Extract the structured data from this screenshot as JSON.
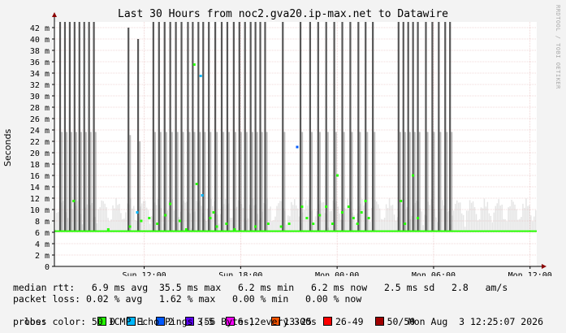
{
  "chart_data": {
    "type": "bar",
    "title": "Last 30 Hours from noc2.gva20.ip-max.net to Datawire",
    "ylabel": "Seconds",
    "ylim": [
      0,
      0.043
    ],
    "yticks": [
      0,
      0.002,
      0.004,
      0.006,
      0.008,
      0.01,
      0.012,
      0.014,
      0.016,
      0.018,
      0.02,
      0.022,
      0.024,
      0.026,
      0.028,
      0.03,
      0.032,
      0.034,
      0.036,
      0.038,
      0.04,
      0.042
    ],
    "ytick_labels": [
      "0",
      "2 m",
      "4 m",
      "6 m",
      "8 m",
      "10 m",
      "12 m",
      "14 m",
      "16 m",
      "18 m",
      "20 m",
      "22 m",
      "24 m",
      "26 m",
      "28 m",
      "30 m",
      "32 m",
      "34 m",
      "36 m",
      "38 m",
      "40 m",
      "42 m"
    ],
    "xlim": [
      0,
      30
    ],
    "xticks": [
      5.583,
      11.583,
      17.583,
      23.583,
      29.583
    ],
    "xtick_labels": [
      "Sun 12:00",
      "Sun 18:00",
      "Mon 00:00",
      "Mon 06:00",
      "Mon 12:00"
    ],
    "grid": true,
    "median_rtt_s": 0.0062,
    "spikes": [
      {
        "x": 0.35,
        "top": 0.043
      },
      {
        "x": 0.65,
        "top": 0.043
      },
      {
        "x": 0.95,
        "top": 0.043
      },
      {
        "x": 1.25,
        "top": 0.043
      },
      {
        "x": 1.55,
        "top": 0.043
      },
      {
        "x": 1.85,
        "top": 0.043
      },
      {
        "x": 2.15,
        "top": 0.043
      },
      {
        "x": 2.45,
        "top": 0.043
      },
      {
        "x": 4.6,
        "top": 0.042
      },
      {
        "x": 5.2,
        "top": 0.04
      },
      {
        "x": 6.15,
        "top": 0.043
      },
      {
        "x": 6.5,
        "top": 0.043
      },
      {
        "x": 6.85,
        "top": 0.043
      },
      {
        "x": 7.2,
        "top": 0.043
      },
      {
        "x": 7.55,
        "top": 0.043
      },
      {
        "x": 7.9,
        "top": 0.043
      },
      {
        "x": 8.3,
        "top": 0.043
      },
      {
        "x": 8.6,
        "top": 0.043
      },
      {
        "x": 8.95,
        "top": 0.043
      },
      {
        "x": 9.25,
        "top": 0.043
      },
      {
        "x": 9.6,
        "top": 0.043
      },
      {
        "x": 10.0,
        "top": 0.043
      },
      {
        "x": 10.4,
        "top": 0.043
      },
      {
        "x": 10.75,
        "top": 0.043
      },
      {
        "x": 11.15,
        "top": 0.043
      },
      {
        "x": 11.5,
        "top": 0.043
      },
      {
        "x": 11.85,
        "top": 0.043
      },
      {
        "x": 12.2,
        "top": 0.043
      },
      {
        "x": 12.5,
        "top": 0.043
      },
      {
        "x": 12.8,
        "top": 0.043
      },
      {
        "x": 13.1,
        "top": 0.043
      },
      {
        "x": 14.2,
        "top": 0.043
      },
      {
        "x": 15.3,
        "top": 0.043
      },
      {
        "x": 15.9,
        "top": 0.043
      },
      {
        "x": 16.4,
        "top": 0.043
      },
      {
        "x": 16.9,
        "top": 0.043
      },
      {
        "x": 17.4,
        "top": 0.043
      },
      {
        "x": 17.9,
        "top": 0.043
      },
      {
        "x": 18.4,
        "top": 0.043
      },
      {
        "x": 18.9,
        "top": 0.043
      },
      {
        "x": 19.35,
        "top": 0.043
      },
      {
        "x": 19.8,
        "top": 0.043
      },
      {
        "x": 21.4,
        "top": 0.043
      },
      {
        "x": 21.7,
        "top": 0.043
      },
      {
        "x": 22.0,
        "top": 0.043
      },
      {
        "x": 22.3,
        "top": 0.043
      },
      {
        "x": 22.6,
        "top": 0.043
      },
      {
        "x": 23.1,
        "top": 0.043
      },
      {
        "x": 23.5,
        "top": 0.043
      },
      {
        "x": 23.9,
        "top": 0.043
      },
      {
        "x": 24.3,
        "top": 0.043
      },
      {
        "x": 24.6,
        "top": 0.043
      }
    ],
    "loss_marks": [
      {
        "x": 1.2,
        "y": 0.0115,
        "loss": "0"
      },
      {
        "x": 3.35,
        "y": 0.0065,
        "loss": "0"
      },
      {
        "x": 4.7,
        "y": 0.007,
        "loss": "0"
      },
      {
        "x": 5.15,
        "y": 0.0095,
        "loss": "1"
      },
      {
        "x": 5.4,
        "y": 0.008,
        "loss": "0"
      },
      {
        "x": 5.9,
        "y": 0.0085,
        "loss": "0"
      },
      {
        "x": 6.4,
        "y": 0.0075,
        "loss": "0"
      },
      {
        "x": 6.9,
        "y": 0.009,
        "loss": "0"
      },
      {
        "x": 7.2,
        "y": 0.011,
        "loss": "0"
      },
      {
        "x": 7.8,
        "y": 0.008,
        "loss": "0"
      },
      {
        "x": 8.2,
        "y": 0.0065,
        "loss": "0"
      },
      {
        "x": 8.7,
        "y": 0.0355,
        "loss": "0"
      },
      {
        "x": 8.85,
        "y": 0.0145,
        "loss": "0"
      },
      {
        "x": 9.1,
        "y": 0.0335,
        "loss": "1"
      },
      {
        "x": 9.2,
        "y": 0.0125,
        "loss": "1"
      },
      {
        "x": 9.7,
        "y": 0.0085,
        "loss": "0"
      },
      {
        "x": 9.9,
        "y": 0.0095,
        "loss": "0"
      },
      {
        "x": 10.1,
        "y": 0.007,
        "loss": "0"
      },
      {
        "x": 10.7,
        "y": 0.0075,
        "loss": "0"
      },
      {
        "x": 11.2,
        "y": 0.0065,
        "loss": "0"
      },
      {
        "x": 12.5,
        "y": 0.007,
        "loss": "0"
      },
      {
        "x": 13.3,
        "y": 0.0075,
        "loss": "0"
      },
      {
        "x": 14.1,
        "y": 0.007,
        "loss": "0"
      },
      {
        "x": 14.6,
        "y": 0.0075,
        "loss": "0"
      },
      {
        "x": 15.1,
        "y": 0.021,
        "loss": "2"
      },
      {
        "x": 15.4,
        "y": 0.0105,
        "loss": "0"
      },
      {
        "x": 15.7,
        "y": 0.0085,
        "loss": "0"
      },
      {
        "x": 16.1,
        "y": 0.0075,
        "loss": "0"
      },
      {
        "x": 16.5,
        "y": 0.009,
        "loss": "0"
      },
      {
        "x": 16.9,
        "y": 0.0105,
        "loss": "0"
      },
      {
        "x": 17.3,
        "y": 0.0075,
        "loss": "0"
      },
      {
        "x": 17.6,
        "y": 0.016,
        "loss": "0"
      },
      {
        "x": 17.9,
        "y": 0.0095,
        "loss": "0"
      },
      {
        "x": 18.3,
        "y": 0.0105,
        "loss": "0"
      },
      {
        "x": 18.6,
        "y": 0.0085,
        "loss": "0"
      },
      {
        "x": 18.85,
        "y": 0.0075,
        "loss": "0"
      },
      {
        "x": 19.1,
        "y": 0.0095,
        "loss": "0"
      },
      {
        "x": 19.35,
        "y": 0.0115,
        "loss": "0"
      },
      {
        "x": 19.55,
        "y": 0.0085,
        "loss": "0"
      },
      {
        "x": 21.55,
        "y": 0.0115,
        "loss": "0"
      },
      {
        "x": 21.8,
        "y": 0.0075,
        "loss": "0"
      },
      {
        "x": 22.3,
        "y": 0.016,
        "loss": "0"
      },
      {
        "x": 22.6,
        "y": 0.0085,
        "loss": "0"
      }
    ]
  },
  "watermark": "RRDTOOL / TOBI OETIKER",
  "stats": {
    "median_rtt": "median rtt:   6.9 ms avg  35.5 ms max   6.2 ms min   6.2 ms now   2.5 ms sd   2.8   am/s",
    "packet_loss": "packet loss: 0.02 % avg   1.62 % max   0.00 % min   0.00 % now",
    "loss_color_label": "loss color:",
    "loss_colors": [
      {
        "label": "0",
        "color": "#26ff00"
      },
      {
        "label": "1",
        "color": "#00b8ff"
      },
      {
        "label": "2",
        "color": "#0059ff"
      },
      {
        "label": "3-5",
        "color": "#5e00ff"
      },
      {
        "label": "6-12",
        "color": "#ff00ff"
      },
      {
        "label": "13-25",
        "color": "#ff5500"
      },
      {
        "label": "26-49",
        "color": "#ff0000"
      },
      {
        "label": "50/50",
        "color": "#a10000"
      }
    ],
    "probe": "probe:        50 ICMP Echo Pings (56 Bytes) every 300s",
    "timestamp": "Mon Aug  3 12:25:07 2026"
  }
}
